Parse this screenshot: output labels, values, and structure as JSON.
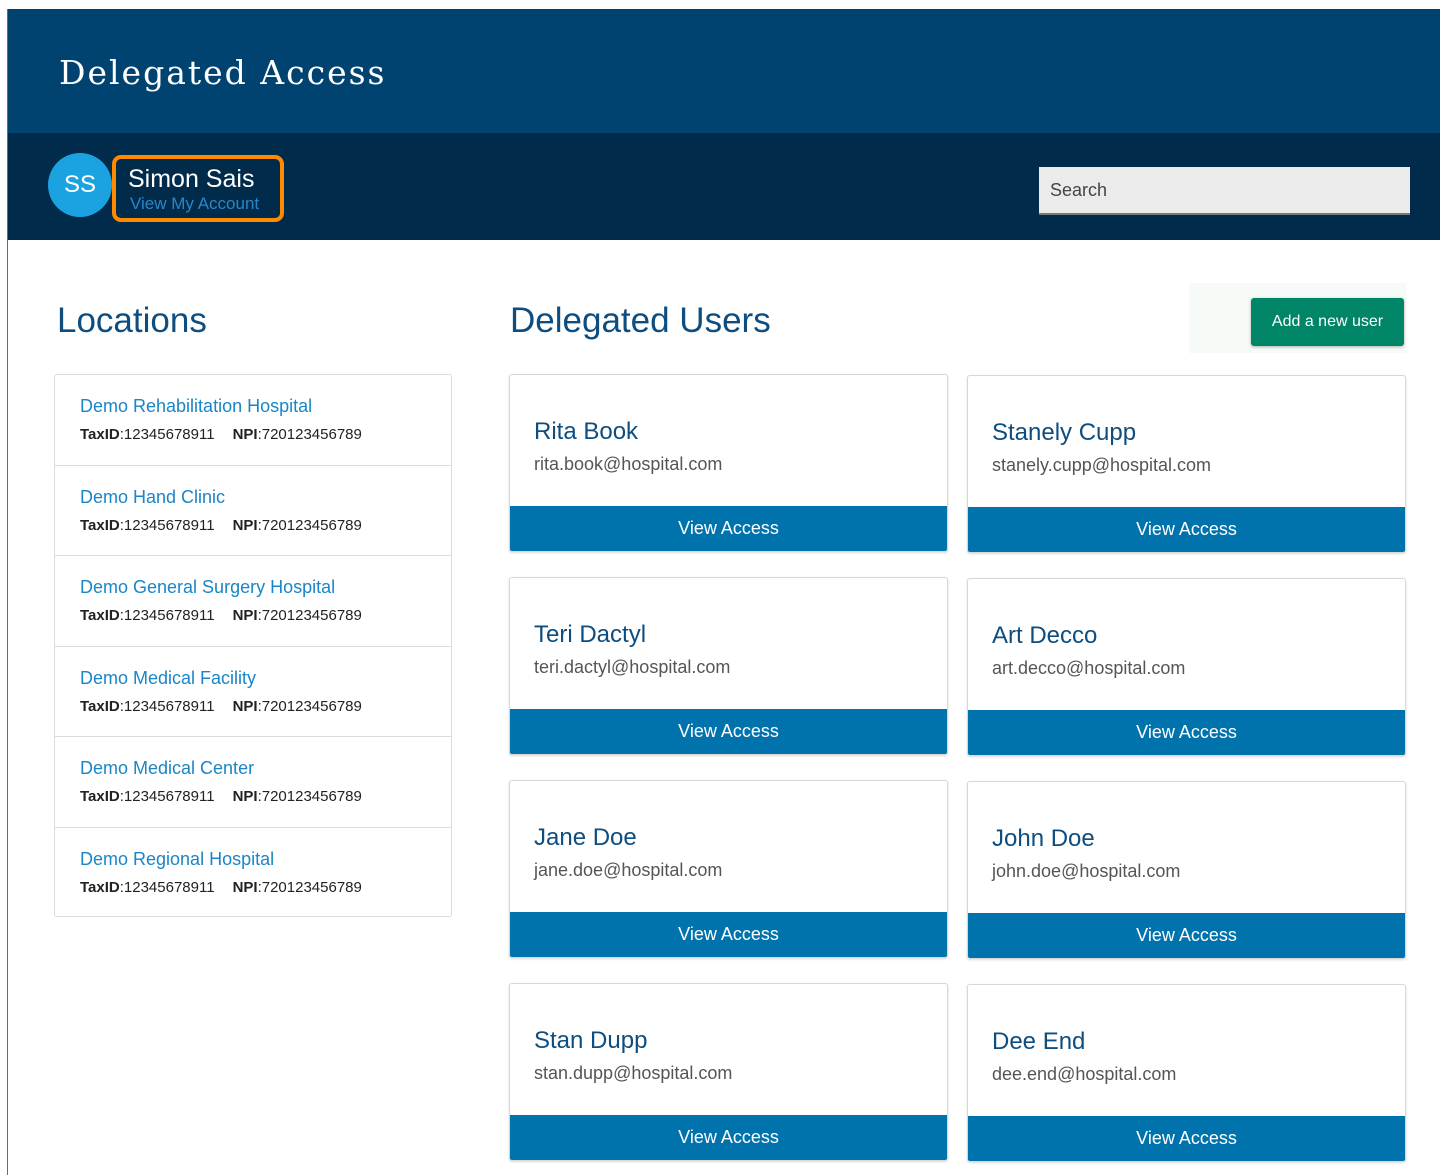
{
  "header": {
    "title": "Delegated Access"
  },
  "user": {
    "initials": "SS",
    "name": "Simon Sais",
    "account_link": "View My Account"
  },
  "search": {
    "placeholder": "Search"
  },
  "locations": {
    "title": "Locations",
    "taxid_label": "TaxID",
    "npi_label": "NPI",
    "items": [
      {
        "name": "Demo Rehabilitation Hospital",
        "taxid": "12345678911",
        "npi": "720123456789"
      },
      {
        "name": "Demo Hand Clinic",
        "taxid": "12345678911",
        "npi": "720123456789"
      },
      {
        "name": "Demo General Surgery Hospital",
        "taxid": "12345678911",
        "npi": "720123456789"
      },
      {
        "name": "Demo Medical Facility",
        "taxid": "12345678911",
        "npi": "720123456789"
      },
      {
        "name": "Demo Medical Center",
        "taxid": "12345678911",
        "npi": "720123456789"
      },
      {
        "name": "Demo Regional Hospital",
        "taxid": "12345678911",
        "npi": "720123456789"
      }
    ]
  },
  "delegated_users": {
    "title": "Delegated Users",
    "add_button": "Add a new user",
    "view_button": "View Access",
    "items": [
      {
        "name": "Rita Book",
        "email": "rita.book@hospital.com"
      },
      {
        "name": "Stanely Cupp",
        "email": "stanely.cupp@hospital.com"
      },
      {
        "name": "Teri Dactyl",
        "email": "teri.dactyl@hospital.com"
      },
      {
        "name": "Art Decco",
        "email": "art.decco@hospital.com"
      },
      {
        "name": "Jane Doe",
        "email": "jane.doe@hospital.com"
      },
      {
        "name": "John Doe",
        "email": "john.doe@hospital.com"
      },
      {
        "name": "Stan Dupp",
        "email": "stan.dupp@hospital.com"
      },
      {
        "name": "Dee End",
        "email": "dee.end@hospital.com"
      }
    ]
  },
  "colors": {
    "banner": "#004370",
    "user_bar": "#002b4a",
    "avatar": "#1aa3e0",
    "highlight_outline": "#ff8a00",
    "link": "#1a85c7",
    "heading": "#0d4d7f",
    "primary_button": "#0073ad",
    "add_button": "#008566"
  }
}
